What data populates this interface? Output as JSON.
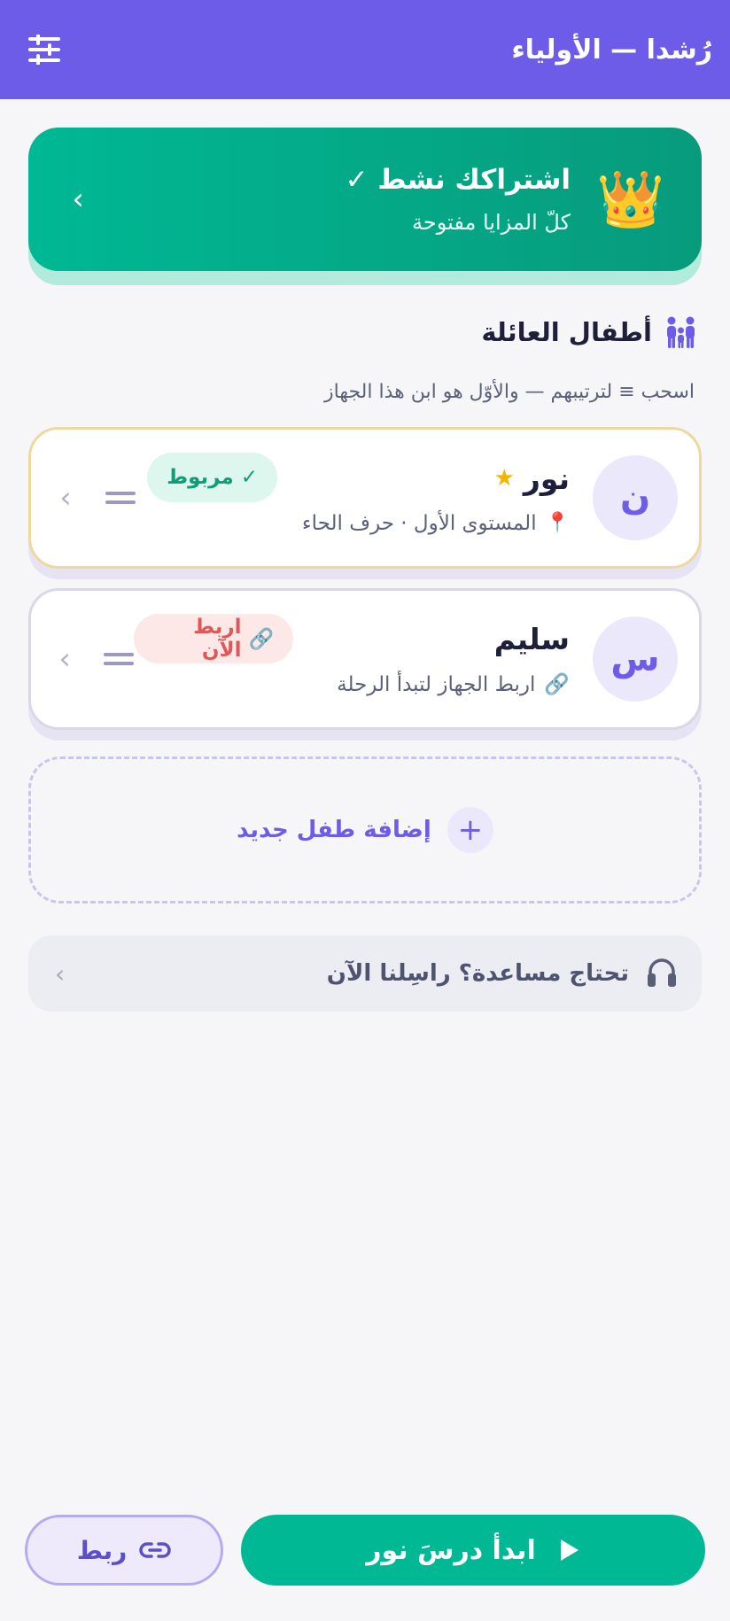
{
  "header": {
    "title": "رُشدا — الأولياء",
    "filter_icon": "sliders-icon"
  },
  "subscription": {
    "title": "اشتراكك نشط ✓",
    "description": "كلّ المزايا مفتوحة",
    "icon": "👑",
    "chevron": "›"
  },
  "children_section": {
    "title": "أطفال العائلة",
    "hint": "اسحب ≡ لترتيبهم — والأوّل هو ابن هذا الجهاز"
  },
  "children": [
    {
      "initial": "ن",
      "name": "نور",
      "star": "★",
      "pin": "📍",
      "detail": "المستوى الأول · حرف الحاء",
      "badge_label": "✓ مربوط",
      "chevron": "›"
    },
    {
      "initial": "س",
      "name": "سليم",
      "detail_icon": "🔗",
      "detail": "اربط الجهاز لتبدأ الرحلة",
      "badge_icon": "🔗",
      "badge_label": "اربط الآن",
      "chevron": "›"
    }
  ],
  "add_child": {
    "plus": "+",
    "label": "إضافة طفل جديد"
  },
  "help": {
    "label": "تحتاج مساعدة؟ راسِلنا الآن",
    "chevron": "›"
  },
  "actions": {
    "start_label": "ابدأ درسَ نور",
    "link_label": "ربط"
  },
  "colors": {
    "primary": "#6c5ce7",
    "accent_green": "#00b894",
    "danger": "#e05757"
  }
}
